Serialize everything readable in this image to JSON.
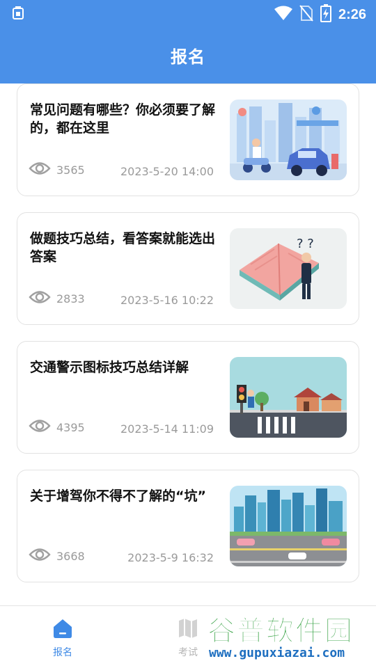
{
  "status_bar": {
    "time": "2:26"
  },
  "app_bar": {
    "title": "报名"
  },
  "articles": [
    {
      "title": "常见问题有哪些？你必须要了解的，都在这里",
      "views": "3565",
      "date": "2023-5-20 14:00",
      "thumbnail": "illustration-city-scooter-car"
    },
    {
      "title": "做题技巧总结，看答案就能选出答案",
      "views": "2833",
      "date": "2023-5-16 10:22",
      "thumbnail": "illustration-open-book-thinking-man"
    },
    {
      "title": "交通警示图标技巧总结详解",
      "views": "4395",
      "date": "2023-5-14 11:09",
      "thumbnail": "illustration-crosswalk-traffic-light"
    },
    {
      "title": "关于增驾你不得不了解的“坑”",
      "views": "3668",
      "date": "2023-5-9 16:32",
      "thumbnail": "illustration-city-highway"
    }
  ],
  "tab_bar": {
    "tabs": [
      {
        "label": "报名",
        "icon": "home-icon",
        "active": true
      },
      {
        "label": "考试",
        "icon": "map-icon",
        "active": false
      }
    ]
  },
  "watermark": {
    "brand": "谷普软件园",
    "url": "www.gupuxiazai.com"
  },
  "colors": {
    "primary": "#4a90e8",
    "tab_active": "#3f8ae6",
    "muted": "#9a9a9a"
  }
}
